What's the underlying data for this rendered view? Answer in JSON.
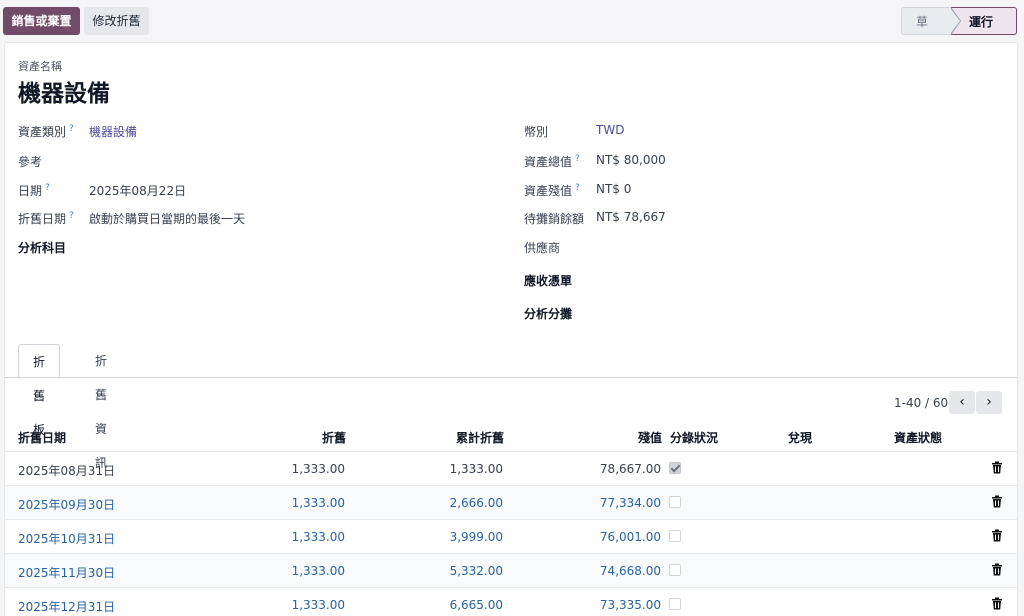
{
  "toolbar": {
    "sell_dispose_label": "銷售或棄置",
    "modify_label": "修改折舊"
  },
  "status": {
    "draft": "草稿",
    "running": "運行中"
  },
  "asset": {
    "label": "資產名稱",
    "name": "機器設備"
  },
  "left_fields": {
    "category_label": "資產類別",
    "category_value": "機器設備",
    "reference_label": "參考",
    "date_label": "日期",
    "date_value": "2025年08月22日",
    "dep_date_label": "折舊日期",
    "dep_date_value": "啟動於購買日當期的最後一天",
    "analytic_label": "分析科目"
  },
  "right_fields": {
    "currency_label": "幣別",
    "currency_value": "TWD",
    "gross_label": "資產總值",
    "gross_value": "NT$ 80,000",
    "salvage_label": "資產殘值",
    "salvage_value": "NT$ 0",
    "residual_label": "待攤銷餘額",
    "residual_value": "NT$ 78,667",
    "vendor_label": "供應商",
    "bills_label": "應收憑單",
    "analytic_dist_label": "分析分攤"
  },
  "help_mark": "?",
  "tabs": {
    "board": "折舊板",
    "info": "折舊資訊"
  },
  "pager": {
    "text": "1-40 / 60",
    "prev": "‹",
    "next": "›"
  },
  "table": {
    "headers": {
      "date": "折舊日期",
      "depreciation": "折舊",
      "cumulative": "累計折舊",
      "residual": "殘值",
      "entry_status": "分錄狀況",
      "realized": "兌現",
      "asset_status": "資產狀態"
    },
    "rows": [
      {
        "date": "2025年08月31日",
        "depreciation": "1,333.00",
        "cumulative": "1,333.00",
        "residual": "78,667.00",
        "posted": true
      },
      {
        "date": "2025年09月30日",
        "depreciation": "1,333.00",
        "cumulative": "2,666.00",
        "residual": "77,334.00",
        "posted": false
      },
      {
        "date": "2025年10月31日",
        "depreciation": "1,333.00",
        "cumulative": "3,999.00",
        "residual": "76,001.00",
        "posted": false
      },
      {
        "date": "2025年11月30日",
        "depreciation": "1,333.00",
        "cumulative": "5,332.00",
        "residual": "74,668.00",
        "posted": false
      },
      {
        "date": "2025年12月31日",
        "depreciation": "1,333.00",
        "cumulative": "6,665.00",
        "residual": "73,335.00",
        "posted": false
      }
    ]
  },
  "colors": {
    "brand": "#714b67",
    "link": "#2563a8"
  }
}
